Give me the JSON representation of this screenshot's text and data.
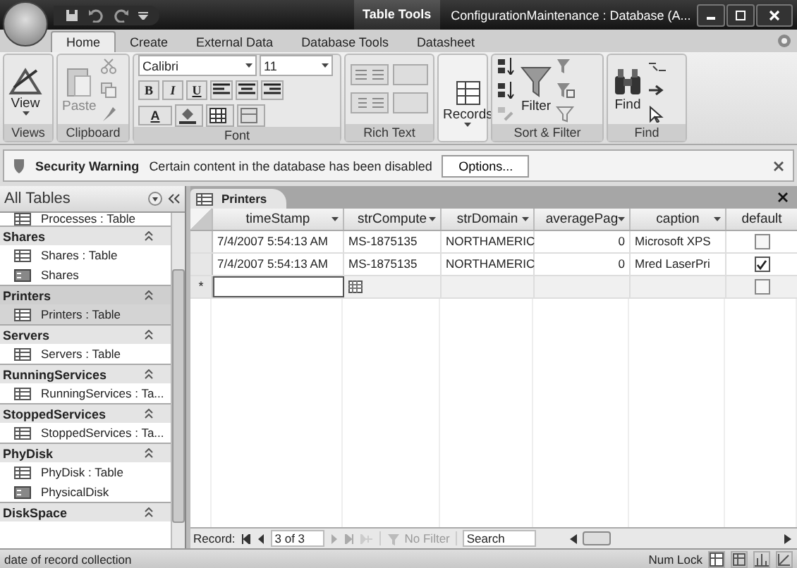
{
  "title_bar": {
    "context_tab": "Table Tools",
    "title": "ConfigurationMaintenance : Database (A..."
  },
  "ribbon_tabs": [
    {
      "label": "Home",
      "selected": true
    },
    {
      "label": "Create",
      "selected": false
    },
    {
      "label": "External Data",
      "selected": false
    },
    {
      "label": "Database Tools",
      "selected": false
    },
    {
      "label": "Datasheet",
      "selected": false
    }
  ],
  "ribbon_groups": [
    {
      "kind": "views",
      "label": "Views",
      "button": "View"
    },
    {
      "kind": "clipboard",
      "label": "Clipboard",
      "button": "Paste"
    },
    {
      "kind": "font",
      "label": "Font",
      "font": "Calibri",
      "size": "11",
      "styles": [
        "B",
        "I",
        "U"
      ],
      "color_letter": "A"
    },
    {
      "kind": "richtext",
      "label": "Rich Text"
    },
    {
      "kind": "records",
      "button": "Records"
    },
    {
      "kind": "sort",
      "label": "Sort & Filter",
      "button": "Filter"
    },
    {
      "kind": "find",
      "label": "Find",
      "button": "Find"
    }
  ],
  "security_bar": {
    "title": "Security Warning",
    "message": "Certain content in the database has been disabled",
    "button": "Options..."
  },
  "navigation": {
    "header": "All Tables",
    "partial_item": "Processes : Table",
    "groups": [
      {
        "name": "Shares",
        "selected": false,
        "items": [
          {
            "kind": "table",
            "label": "Shares : Table",
            "selected": false
          },
          {
            "kind": "query",
            "label": "Shares",
            "selected": false
          }
        ]
      },
      {
        "name": "Printers",
        "selected": true,
        "items": [
          {
            "kind": "table",
            "label": "Printers : Table",
            "selected": true
          }
        ]
      },
      {
        "name": "Servers",
        "selected": false,
        "items": [
          {
            "kind": "table",
            "label": "Servers : Table",
            "selected": false
          }
        ]
      },
      {
        "name": "RunningServices",
        "selected": false,
        "items": [
          {
            "kind": "table",
            "label": "RunningServices : Ta...",
            "selected": false
          }
        ]
      },
      {
        "name": "StoppedServices",
        "selected": false,
        "items": [
          {
            "kind": "table",
            "label": "StoppedServices : Ta...",
            "selected": false
          }
        ]
      },
      {
        "name": "PhyDisk",
        "selected": false,
        "items": [
          {
            "kind": "table",
            "label": "PhyDisk : Table",
            "selected": false
          },
          {
            "kind": "query",
            "label": "PhysicalDisk",
            "selected": false
          }
        ]
      },
      {
        "name": "DiskSpace",
        "selected": false
      }
    ]
  },
  "datasheet": {
    "tab": "Printers",
    "columns": [
      "timeStamp",
      "strCompute",
      "strDomain",
      "averagePag",
      "caption",
      "default"
    ],
    "rows": [
      {
        "cells": [
          "7/4/2007 5:54:13 AM",
          "MS-1875135",
          "NORTHAMERIC",
          "0",
          "Microsoft XPS"
        ],
        "checked": false
      },
      {
        "cells": [
          "7/4/2007 5:54:13 AM",
          "MS-1875135",
          "NORTHAMERIC",
          "0",
          "Mred LaserPri"
        ],
        "checked": true
      }
    ],
    "new_row": {
      "marker": "*",
      "checked": false
    },
    "record_nav": {
      "label": "Record:",
      "position": "3 of 3",
      "filter": "No Filter",
      "search": "Search"
    }
  },
  "status_bar": {
    "text": "date of record collection",
    "num_lock": "Num Lock"
  }
}
